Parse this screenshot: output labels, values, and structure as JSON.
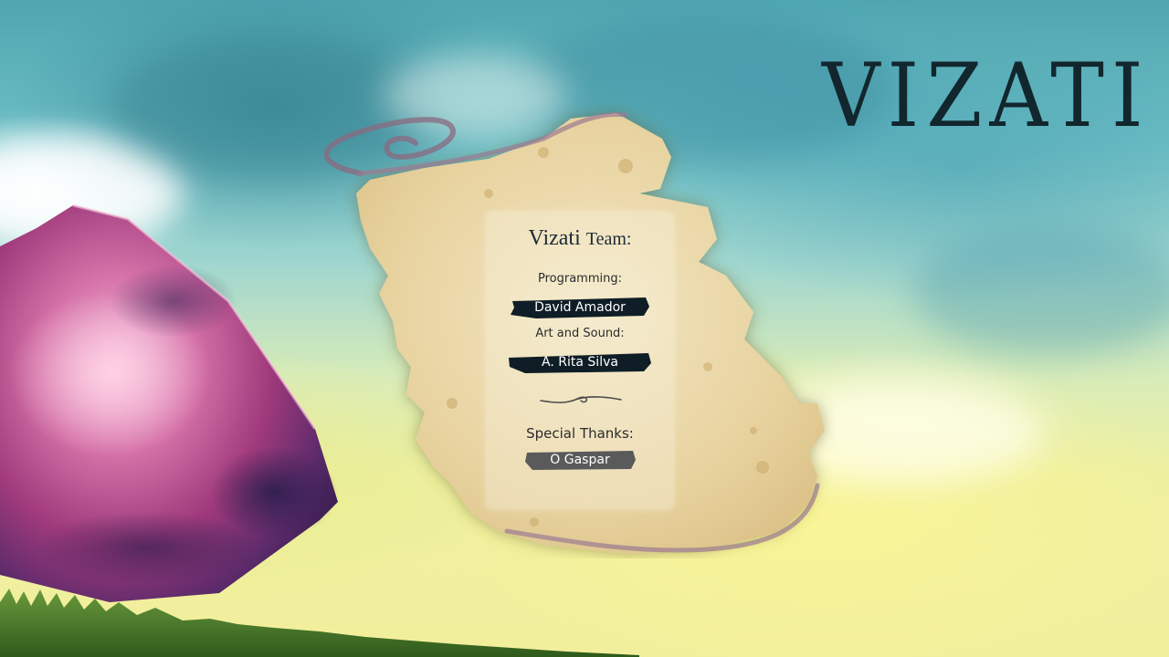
{
  "game": {
    "logo_text": "VIZATI"
  },
  "credits": {
    "title_main": "Vizati",
    "title_suffix": "Team:",
    "sections": [
      {
        "label": "Programming:",
        "name": "David Amador",
        "tag_color": "#0f1e26"
      },
      {
        "label": "Art and Sound:",
        "name": "A. Rita Silva",
        "tag_color": "#0f1e26"
      }
    ],
    "divider_icon": "ornament-flourish-icon",
    "thanks_label": "Special Thanks:",
    "thanks_name": "O Gaspar",
    "thanks_tag_color": "#5a5a5a"
  },
  "colors": {
    "sky_top": "#4fa6b0",
    "sky_bottom": "#f2ef9c",
    "parchment": "#ecd9a8",
    "gem": "#b03a78"
  }
}
